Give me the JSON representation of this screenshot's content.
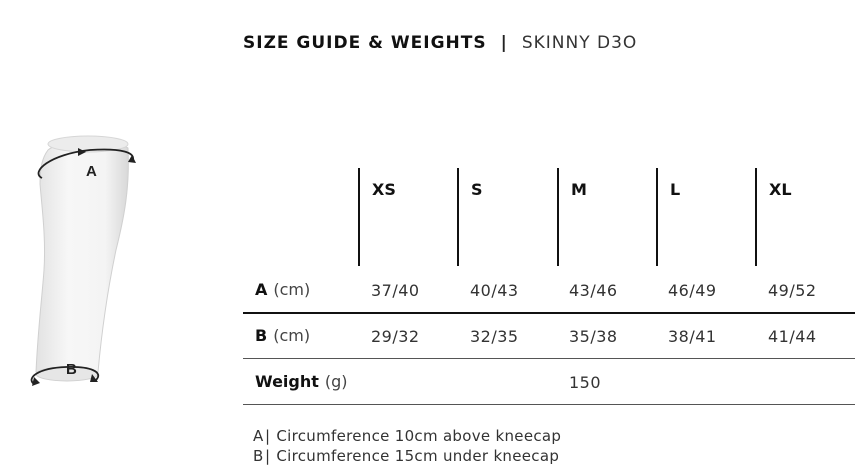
{
  "header": {
    "title": "SIZE GUIDE & WEIGHTS",
    "separator": "|",
    "model": "SKINNY D3O"
  },
  "illustration": {
    "label_a": "A",
    "label_b": "B"
  },
  "table": {
    "columns": [
      "XS",
      "S",
      "M",
      "L",
      "XL"
    ],
    "rows": [
      {
        "label": "A",
        "unit": "(cm)",
        "values": [
          "37/40",
          "40/43",
          "43/46",
          "46/49",
          "49/52"
        ]
      },
      {
        "label": "B",
        "unit": "(cm)",
        "values": [
          "29/32",
          "32/35",
          "35/38",
          "38/41",
          "41/44"
        ]
      },
      {
        "label": "Weight",
        "unit": "(g)",
        "values": [
          "",
          "",
          "150",
          "",
          ""
        ]
      }
    ]
  },
  "notes": [
    {
      "letter": "A",
      "bar": "|",
      "text": "Circumference 10cm above kneecap"
    },
    {
      "letter": "B",
      "bar": "|",
      "text": "Circumference 15cm under kneecap"
    }
  ]
}
